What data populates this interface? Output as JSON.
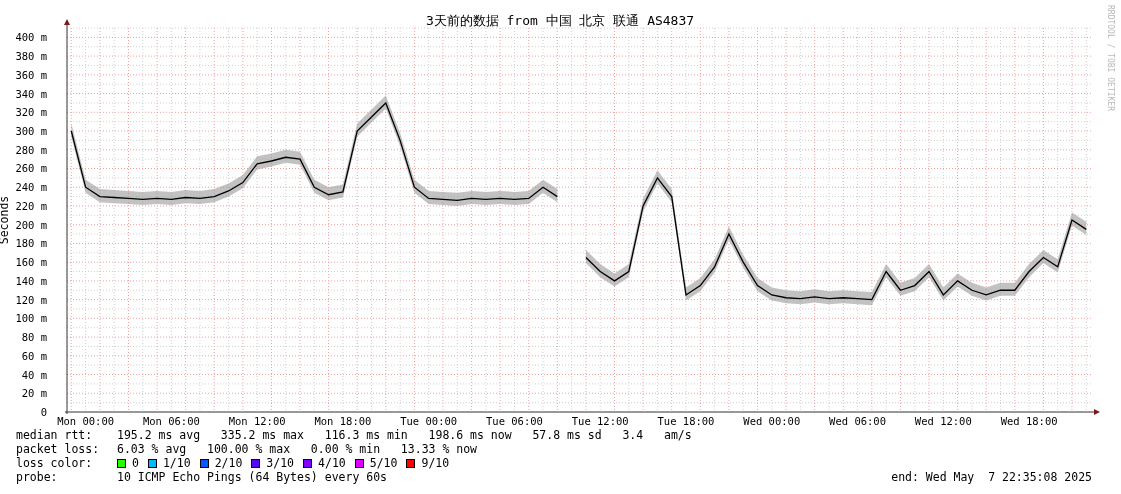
{
  "chart": {
    "credit": "RRDTOOL / TOBI OETIKER",
    "chart_data": {
      "type": "line",
      "title": "3天前的数据 from 中国 北京 联通 AS4837",
      "ylabel": "Seconds",
      "categories": [
        null,
        "Mon 00:00",
        null,
        null,
        null,
        null,
        null,
        "Mon 06:00",
        null,
        null,
        null,
        null,
        null,
        "Mon 12:00",
        null,
        null,
        null,
        null,
        null,
        "Mon 18:00",
        null,
        null,
        null,
        null,
        null,
        "Tue 00:00",
        null,
        null,
        null,
        null,
        null,
        "Tue 06:00",
        null,
        null,
        null,
        null,
        null,
        "Tue 12:00",
        null,
        null,
        null,
        null,
        null,
        "Tue 18:00",
        null,
        null,
        null,
        null,
        null,
        "Wed 00:00",
        null,
        null,
        null,
        null,
        null,
        "Wed 06:00",
        null,
        null,
        null,
        null,
        null,
        "Wed 12:00",
        null,
        null,
        null,
        null,
        null,
        "Wed 18:00",
        null,
        null,
        null,
        null
      ],
      "series": [
        {
          "color": "#000000",
          "values": [
            300,
            240,
            230,
            229,
            228,
            227,
            228,
            227,
            229,
            228,
            230,
            236,
            245,
            265,
            268,
            272,
            270,
            240,
            232,
            235,
            300,
            315,
            330,
            290,
            240,
            228,
            227,
            226,
            228,
            227,
            228,
            227,
            228,
            240,
            230,
            null,
            165,
            150,
            140,
            150,
            220,
            250,
            230,
            125,
            135,
            155,
            190,
            160,
            135,
            125,
            122,
            121,
            123,
            121,
            122,
            121,
            120,
            150,
            130,
            135,
            150,
            125,
            140,
            130,
            125,
            130,
            130,
            150,
            165,
            155,
            205,
            195
          ]
        }
      ],
      "ylim": [
        0,
        410
      ],
      "grid": true,
      "yticks": [
        {
          "value": 0,
          "label": "0"
        },
        {
          "value": 20,
          "label": "20 m"
        },
        {
          "value": 40,
          "label": "40 m"
        },
        {
          "value": 60,
          "label": "60 m"
        },
        {
          "value": 80,
          "label": "80 m"
        },
        {
          "value": 100,
          "label": "100 m"
        },
        {
          "value": 120,
          "label": "120 m"
        },
        {
          "value": 140,
          "label": "140 m"
        },
        {
          "value": 160,
          "label": "160 m"
        },
        {
          "value": 180,
          "label": "180 m"
        },
        {
          "value": 200,
          "label": "200 m"
        },
        {
          "value": 220,
          "label": "220 m"
        },
        {
          "value": 240,
          "label": "240 m"
        },
        {
          "value": 260,
          "label": "260 m"
        },
        {
          "value": 280,
          "label": "280 m"
        },
        {
          "value": 300,
          "label": "300 m"
        },
        {
          "value": 320,
          "label": "320 m"
        },
        {
          "value": 340,
          "label": "340 m"
        },
        {
          "value": 360,
          "label": "360 m"
        },
        {
          "value": 380,
          "label": "380 m"
        },
        {
          "value": 400,
          "label": "400 m"
        }
      ]
    }
  },
  "legend": {
    "rows": [
      {
        "label": "median rtt:",
        "value": "195.2 ms avg   335.2 ms max   116.3 ms min   198.6 ms now   57.8 ms sd   3.4   am/s"
      },
      {
        "label": "packet loss:",
        "value": "6.03 % avg   100.00 % max   0.00 % min   13.33 % now"
      }
    ],
    "loss_color": {
      "label": "loss color:",
      "items": [
        {
          "label": "0",
          "color": "#26ff00"
        },
        {
          "label": "1/10",
          "color": "#00b8ff"
        },
        {
          "label": "2/10",
          "color": "#0059ff"
        },
        {
          "label": "3/10",
          "color": "#5e00ff"
        },
        {
          "label": "4/10",
          "color": "#7e00ff"
        },
        {
          "label": "5/10",
          "color": "#dd00ff"
        },
        {
          "label": "9/10",
          "color": "#ff0000"
        }
      ]
    },
    "probe": {
      "label": "probe:",
      "value": "10 ICMP Echo Pings (64 Bytes) every 60s"
    },
    "end": "end: Wed May  7 22:35:08 2025"
  }
}
